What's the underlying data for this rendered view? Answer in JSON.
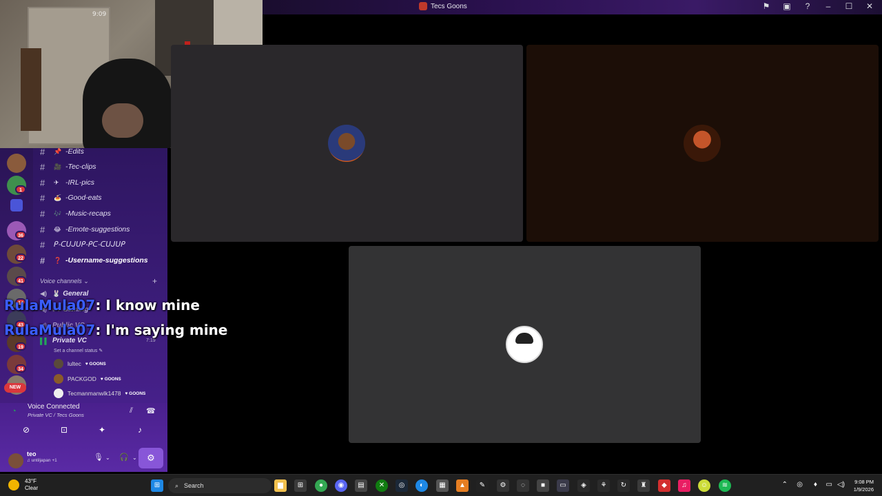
{
  "window": {
    "title": "Tecs Goons",
    "accent": "#5865f2"
  },
  "channels": [
    {
      "name": "-Edits",
      "emoji": "📌",
      "bold": false
    },
    {
      "name": "-Tec-clips",
      "emoji": "🎥",
      "bold": false
    },
    {
      "name": "-IRL-pics",
      "emoji": "✈",
      "bold": false
    },
    {
      "name": "-Good-eats",
      "emoji": "🍝",
      "bold": false
    },
    {
      "name": "-Music-recaps",
      "emoji": "🎶",
      "bold": false
    },
    {
      "name": "-Emote-suggestions",
      "emoji": "😂",
      "bold": false
    },
    {
      "name": "ᑭ-ᑕᑌᒍᑌᑭ-ᑭᑕ-ᑕᑌᒍᑌᑭ",
      "emoji": "",
      "bold": false
    },
    {
      "name": "-Username-suggestions",
      "emoji": "❓",
      "bold": true
    }
  ],
  "voice_section": {
    "label": "Voice channels"
  },
  "voice_channels": [
    {
      "name": "General",
      "emoji": "🐰"
    },
    {
      "name": "Gaming",
      "emoji": "🎮"
    },
    {
      "name": "Public VC",
      "emoji": ""
    },
    {
      "name": "Private VC",
      "emoji": ""
    }
  ],
  "private_vc": {
    "time": "7:19",
    "status": "Set a channel status"
  },
  "members": [
    {
      "name": "lultec",
      "tag": "GOONS"
    },
    {
      "name": "PACKGOD",
      "tag": "GOONS"
    },
    {
      "name": "Tecmanmanwlk1478",
      "tag": "GOONS"
    }
  ],
  "server_badges": [
    "1",
    "36",
    "22",
    "41",
    "14",
    "43",
    "19",
    "34"
  ],
  "new_badge": "NEW",
  "voice_panel": {
    "title": "Voice Connected",
    "subtitle": "Private VC / Tecs Goons"
  },
  "user": {
    "name": "teo",
    "status": "untiljapan +1"
  },
  "captions": [
    {
      "nick": "RulaMula07",
      "text": ": I know mine"
    },
    {
      "nick": "RulaMula07",
      "text": ": I'm saying mine"
    }
  ],
  "webcam": {
    "stamp": "9:09"
  },
  "taskbar": {
    "weather_temp": "43°F",
    "weather_desc": "Clear",
    "search_label": "Search",
    "time": "9:08 PM",
    "date": "1/9/2026"
  }
}
